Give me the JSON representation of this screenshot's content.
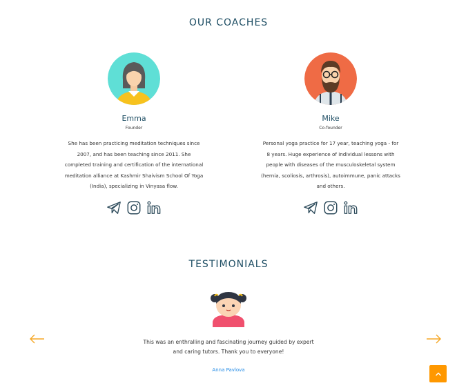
{
  "coaches": {
    "title": "OUR COACHES",
    "items": [
      {
        "name": "Emma",
        "role": "Founder",
        "bio": "She has been practicing meditation techniques since 2007, and has been teaching since 2011. She completed training and certification of the international meditation alliance at Kashmir Shaivism School Of Yoga (India), specializing in Vinyasa flow."
      },
      {
        "name": "Mike",
        "role": "Co-founder",
        "bio": "Personal yoga practice for 17 year, teaching yoga - for 8 years. Huge experience of individual lessons with people with diseases of the musculoskeletal system (hernia, scoliosis, arthrosis), autoimmune, panic attacks and others."
      }
    ],
    "social_icons": [
      "telegram-icon",
      "instagram-icon",
      "linkedin-icon"
    ]
  },
  "testimonials": {
    "title": "TESTIMONIALS",
    "quote": "This was an enthralling and fascinating journey guided by expert and caring tutors. Thank you to everyone!",
    "author": "Anna Pavlova"
  },
  "colors": {
    "heading": "#1d4d63",
    "accent": "#ff9800",
    "author_link": "#1e88e5",
    "emma_bg": "#5fdfd6",
    "mike_bg": "#ef6b45"
  }
}
